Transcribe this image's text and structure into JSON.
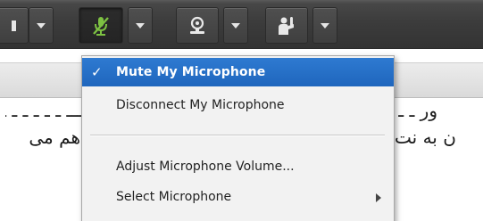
{
  "toolbar": {
    "buttons": [
      {
        "name": "speaker",
        "icon": "speaker-icon",
        "active": false
      },
      {
        "name": "microphone",
        "icon": "microphone-muted-icon",
        "active": true,
        "icon_color": "#7dc142"
      },
      {
        "name": "webcam",
        "icon": "webcam-icon",
        "active": false
      },
      {
        "name": "raise-hand",
        "icon": "raise-hand-icon",
        "active": false
      }
    ]
  },
  "background_text": {
    "line1": "ـــ ـ ـ ـ ـ ـ ـــ ـ ـ ـ ـــ",
    "line1_right": "ور ـ ـ",
    "line2_left": "ن به نت",
    "line2_right": "هم می"
  },
  "menu": {
    "items": [
      {
        "label": "Mute My Microphone",
        "checked": true,
        "selected": true
      },
      {
        "label": "Disconnect My Microphone",
        "checked": false,
        "selected": false
      },
      {
        "label": "Adjust Microphone Volume...",
        "checked": false,
        "selected": false
      },
      {
        "label": "Select Microphone",
        "checked": false,
        "selected": false,
        "has_submenu": true
      }
    ],
    "check_glyph": "✓"
  },
  "colors": {
    "toolbar_bg": "#3c3c3c",
    "selection": "#2670c8",
    "mic_icon": "#7dc142"
  }
}
